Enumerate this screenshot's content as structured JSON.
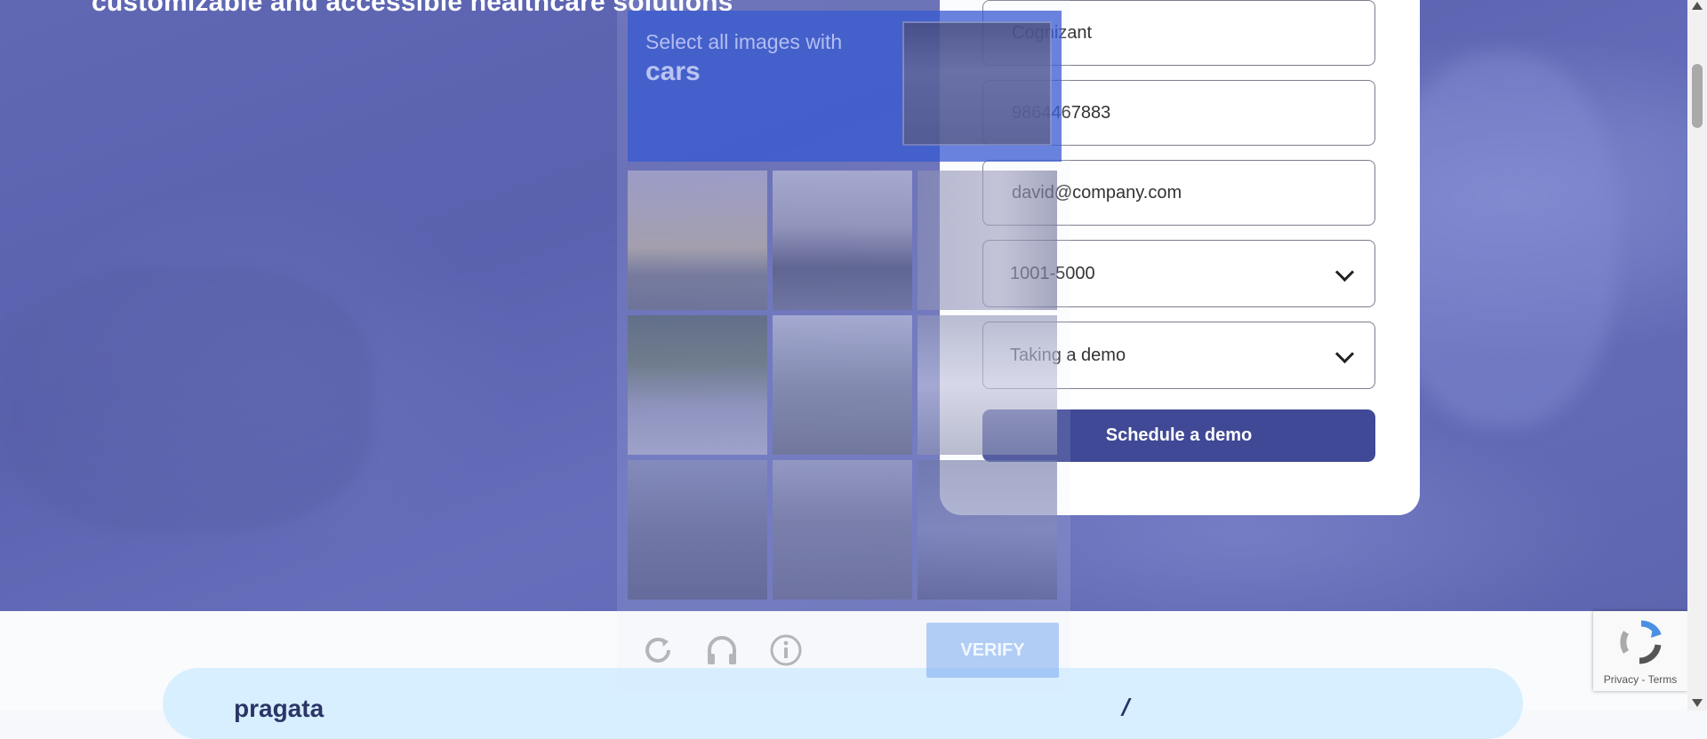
{
  "hero": {
    "heading": "customizable and accessible healthcare solutions"
  },
  "form": {
    "company": "Cognizant",
    "phone": "9864467883",
    "email": "david@company.com",
    "company_size": "1001-5000",
    "interest": "Taking a demo",
    "submit_label": "Schedule a demo"
  },
  "captcha": {
    "prompt": "Select all images with",
    "target": "cars",
    "verify_label": "VERIFY",
    "icons": [
      "refresh-icon",
      "headphones-icon",
      "info-icon"
    ]
  },
  "recaptcha": {
    "privacy_label": "Privacy",
    "separator": " - ",
    "terms_label": "Terms"
  },
  "lower": {
    "logo_text": "pragata"
  },
  "colors": {
    "hero_bg": "#5f66b2",
    "button_bg": "#404996",
    "verify_bg": "#78aaf0",
    "logo_band": "#d7efff"
  }
}
